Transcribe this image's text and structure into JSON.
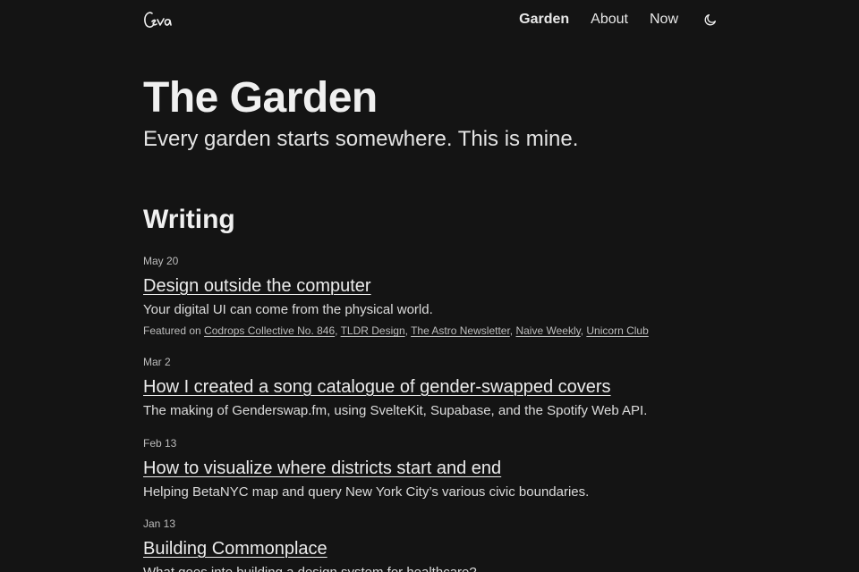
{
  "nav": {
    "logo_text": "Ceva",
    "links": [
      {
        "label": "Garden",
        "active": true
      },
      {
        "label": "About",
        "active": false
      },
      {
        "label": "Now",
        "active": false
      }
    ],
    "theme_toggle_icon": "moon-icon"
  },
  "hero": {
    "title": "The Garden",
    "subtitle": "Every garden starts somewhere. This is mine."
  },
  "writing": {
    "heading": "Writing",
    "posts": [
      {
        "date": "May 20",
        "title": "Design outside the computer",
        "description": "Your digital UI can come from the physical world.",
        "featured_label": "Featured on",
        "featured": [
          "Codrops Collective No. 846",
          "TLDR Design",
          "The Astro Newsletter",
          "Naive Weekly",
          "Unicorn Club"
        ]
      },
      {
        "date": "Mar 2",
        "title": "How I created a song catalogue of gender-swapped covers",
        "description": "The making of Genderswap.fm, using SvelteKit, Supabase, and the Spotify Web API."
      },
      {
        "date": "Feb 13",
        "title": "How to visualize where districts start and end",
        "description": "Helping BetaNYC map and query New York City’s various civic boundaries."
      },
      {
        "date": "Jan 13",
        "title": "Building Commonplace",
        "description": "What goes into building a design system for healthcare?"
      }
    ]
  },
  "colors": {
    "background": "#141414",
    "text": "#e8e8e8",
    "muted": "#bdbdbd"
  }
}
